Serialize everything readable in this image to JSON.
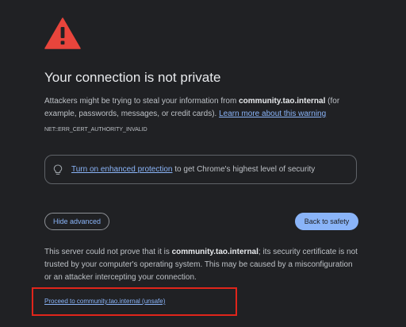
{
  "interstitial": {
    "title": "Your connection is not private",
    "message": {
      "prefix": "Attackers might be trying to steal your information from ",
      "host": "community.tao.internal",
      "suffix": " (for example, passwords, messages, or credit cards). ",
      "learn_more": "Learn more about this warning"
    },
    "error_code": "NET::ERR_CERT_AUTHORITY_INVALID",
    "enhanced_protection": {
      "link": "Turn on enhanced protection",
      "rest": " to get Chrome's highest level of security"
    },
    "hide_advanced_label": "Hide advanced",
    "back_to_safety_label": "Back to safety",
    "details": {
      "prefix": "This server could not prove that it is ",
      "host": "community.tao.internal",
      "suffix": "; its security certificate is not trusted by your computer's operating system. This may be caused by a misconfiguration or an attacker intercepting your connection."
    },
    "proceed_link": "Proceed to community.tao.internal (unsafe)"
  },
  "icons": {
    "warning": "warning-triangle-icon",
    "bulb": "lightbulb-icon"
  },
  "colors": {
    "background": "#202124",
    "warning_red": "#e8453c",
    "link_blue": "#8ab4f8",
    "highlight_red": "#e0251b"
  }
}
